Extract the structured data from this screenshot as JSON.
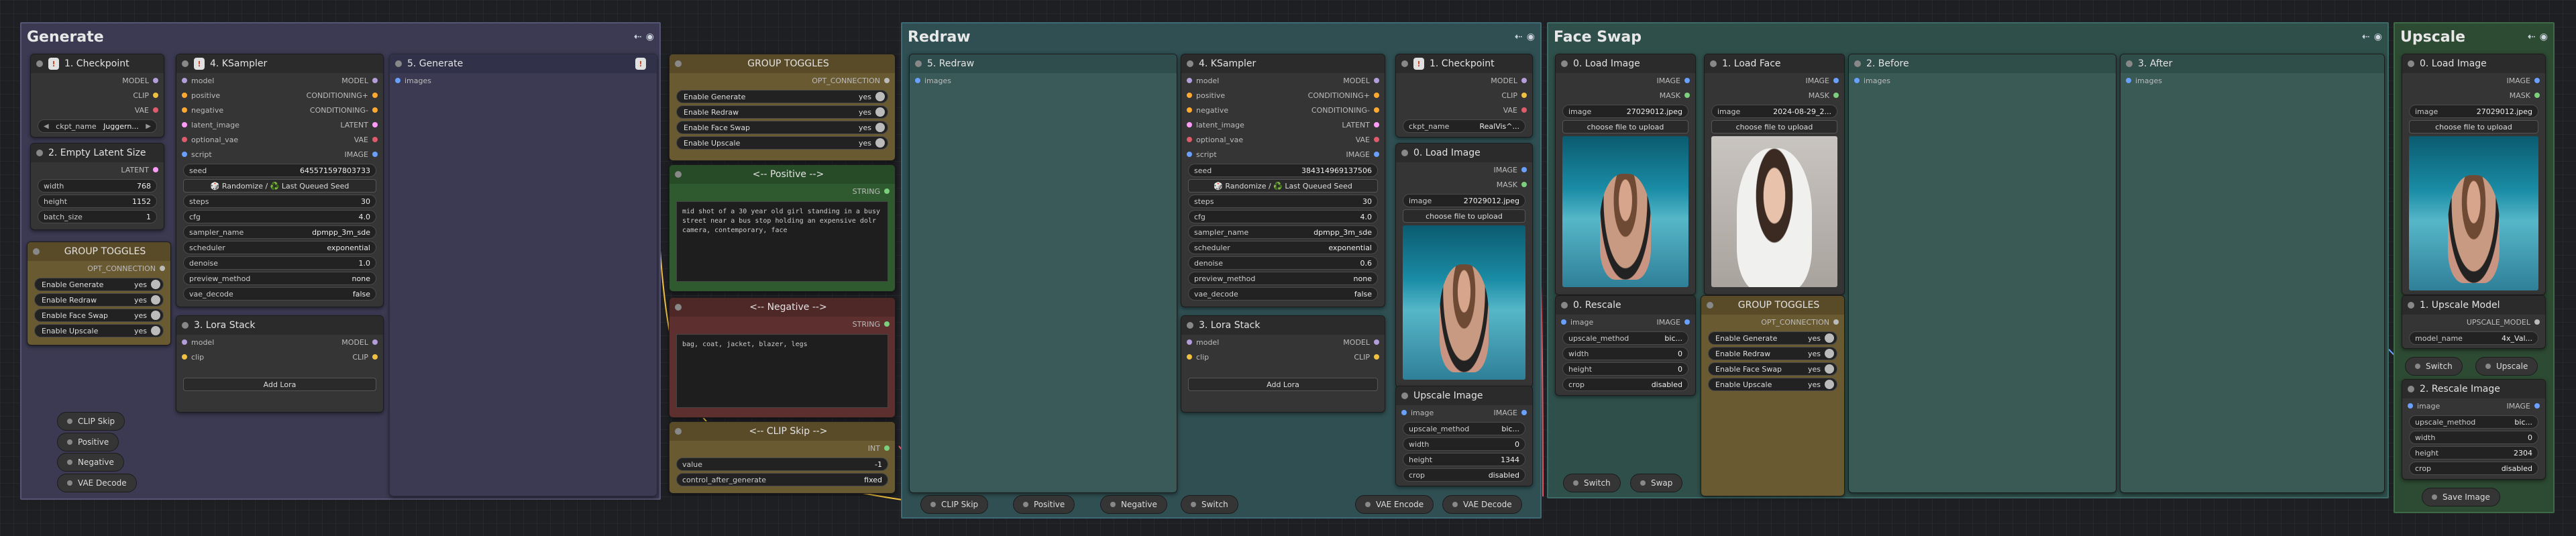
{
  "groups": {
    "generate": "Generate",
    "redraw": "Redraw",
    "faceswap": "Face Swap",
    "upscale": "Upscale"
  },
  "colors": {
    "generate": "#3b3a52",
    "redraw": "#2f4f53",
    "faceswap": "#2f4f4b",
    "upscale": "#2d4a33",
    "toggles": "#6a5a32",
    "positive": "#2f5a2f",
    "negative": "#5e2f2f",
    "clip_skip": "#6a5a32",
    "wire_red": "#e05c6c",
    "wire_yellow": "#f0c040",
    "wire_blue": "#6aa0ff"
  },
  "icons": {
    "pin": "pin-icon",
    "eye": "eye-icon"
  },
  "gen": {
    "checkpoint": {
      "title": "1. Checkpoint",
      "outputs": [
        "MODEL",
        "CLIP",
        "VAE"
      ],
      "widget_label": "ckpt_name",
      "widget_value": "Juggern..."
    },
    "latent": {
      "title": "2. Empty Latent Size",
      "output": "LATENT",
      "width_label": "width",
      "width": "768",
      "height_label": "height",
      "height": "1152",
      "batch_label": "batch_size",
      "batch": "1"
    },
    "toggles": {
      "title": "GROUP TOGGLES",
      "output": "OPT_CONNECTION",
      "items": [
        {
          "label": "Enable Generate",
          "value": "yes"
        },
        {
          "label": "Enable Redraw",
          "value": "yes"
        },
        {
          "label": "Enable Face Swap",
          "value": "yes"
        },
        {
          "label": "Enable Upscale",
          "value": "yes"
        }
      ]
    },
    "ksampler": {
      "title": "4. KSampler",
      "inputs": [
        "model",
        "positive",
        "negative",
        "latent_image",
        "optional_vae",
        "script"
      ],
      "outputs": [
        "MODEL",
        "CONDITIONING+",
        "CONDITIONING-",
        "LATENT",
        "VAE",
        "IMAGE"
      ],
      "seed_label": "seed",
      "seed": "645571597803733",
      "randomize": "🎲 Randomize / ♻️ Last Queued Seed",
      "steps_label": "steps",
      "steps": "30",
      "cfg_label": "cfg",
      "cfg": "4.0",
      "sampler_label": "sampler_name",
      "sampler": "dpmpp_3m_sde",
      "scheduler_label": "scheduler",
      "scheduler": "exponential",
      "denoise_label": "denoise",
      "denoise": "1.0",
      "preview_label": "preview_method",
      "preview": "none",
      "vae_decode_label": "vae_decode",
      "vae_decode": "false"
    },
    "lora": {
      "title": "3. Lora Stack",
      "inputs": [
        "model",
        "clip"
      ],
      "outputs": [
        "MODEL",
        "CLIP"
      ],
      "add": "Add Lora"
    },
    "save": {
      "title": "5. Generate",
      "input": "images"
    },
    "pills": [
      "CLIP Skip",
      "Positive",
      "Negative",
      "VAE Decode"
    ]
  },
  "mid": {
    "toggles": {
      "title": "GROUP TOGGLES",
      "output": "OPT_CONNECTION",
      "items": [
        {
          "label": "Enable Generate",
          "value": "yes"
        },
        {
          "label": "Enable Redraw",
          "value": "yes"
        },
        {
          "label": "Enable Face Swap",
          "value": "yes"
        },
        {
          "label": "Enable Upscale",
          "value": "yes"
        }
      ]
    },
    "positive": {
      "title": "<-- Positive -->",
      "output": "STRING",
      "text": "mid shot of a 30 year old girl standing in a busy street near a bus stop holding an expensive dolr camera, contemporary, face"
    },
    "negative": {
      "title": "<-- Negative -->",
      "output": "STRING",
      "text": "bag, coat, jacket, blazer, legs"
    },
    "clipskip": {
      "title": "<-- CLIP Skip -->",
      "output": "INT",
      "value_label": "value",
      "value": "-1",
      "control_label": "control_after_generate",
      "control": "fixed"
    }
  },
  "redraw": {
    "save": {
      "title": "5. Redraw",
      "input": "images"
    },
    "ksampler": {
      "title": "4. KSampler",
      "inputs": [
        "model",
        "positive",
        "negative",
        "latent_image",
        "optional_vae",
        "script"
      ],
      "outputs": [
        "MODEL",
        "CONDITIONING+",
        "CONDITIONING-",
        "LATENT",
        "VAE",
        "IMAGE"
      ],
      "seed_label": "seed",
      "seed": "384314969137506",
      "randomize": "🎲 Randomize / ♻️ Last Queued Seed",
      "steps_label": "steps",
      "steps": "30",
      "cfg_label": "cfg",
      "cfg": "4.0",
      "sampler_label": "sampler_name",
      "sampler": "dpmpp_3m_sde",
      "scheduler_label": "scheduler",
      "scheduler": "exponential",
      "denoise_label": "denoise",
      "denoise": "0.6",
      "preview_label": "preview_method",
      "preview": "none",
      "vae_decode_label": "vae_decode",
      "vae_decode": "false"
    },
    "lora": {
      "title": "3. Lora Stack",
      "inputs": [
        "model",
        "clip"
      ],
      "outputs": [
        "MODEL",
        "CLIP"
      ],
      "add": "Add Lora"
    },
    "checkpoint": {
      "title": "1. Checkpoint",
      "outputs": [
        "MODEL",
        "CLIP",
        "VAE"
      ],
      "widget_label": "ckpt_name",
      "widget_value": "RealVis^..."
    },
    "load": {
      "title": "0. Load Image",
      "outputs": [
        "IMAGE",
        "MASK"
      ],
      "image_label": "image",
      "image": "27029012.jpeg",
      "upload": "choose file to upload"
    },
    "upscale": {
      "title": "Upscale Image",
      "input": "image",
      "output": "IMAGE",
      "method_label": "upscale_method",
      "method": "bic...",
      "width_label": "width",
      "width": "0",
      "height_label": "height",
      "height": "1344",
      "crop_label": "crop",
      "crop": "disabled"
    },
    "pills": [
      "CLIP Skip",
      "Positive",
      "Negative",
      "Switch",
      "VAE Encode",
      "VAE Decode"
    ]
  },
  "face": {
    "load_image": {
      "title": "0. Load Image",
      "outputs": [
        "IMAGE",
        "MASK"
      ],
      "image_label": "image",
      "image": "27029012.jpeg",
      "upload": "choose file to upload"
    },
    "load_face": {
      "title": "1. Load Face",
      "outputs": [
        "IMAGE",
        "MASK"
      ],
      "image_label": "image",
      "image": "2024-08-29_2...",
      "upload": "choose file to upload"
    },
    "before": {
      "title": "2. Before",
      "input": "images"
    },
    "after": {
      "title": "3. After",
      "input": "images"
    },
    "rescale": {
      "title": "0. Rescale",
      "input": "image",
      "output": "IMAGE",
      "method_label": "upscale_method",
      "method": "bic...",
      "width_label": "width",
      "width": "0",
      "height_label": "height",
      "height": "0",
      "crop_label": "crop",
      "crop": "disabled"
    },
    "toggles": {
      "title": "GROUP TOGGLES",
      "output": "OPT_CONNECTION",
      "items": [
        {
          "label": "Enable Generate",
          "value": "yes"
        },
        {
          "label": "Enable Redraw",
          "value": "yes"
        },
        {
          "label": "Enable Face Swap",
          "value": "yes"
        },
        {
          "label": "Enable Upscale",
          "value": "yes"
        }
      ]
    },
    "pills": [
      "Switch",
      "Swap"
    ]
  },
  "up": {
    "load": {
      "title": "0. Load Image",
      "outputs": [
        "IMAGE",
        "MASK"
      ],
      "image_label": "image",
      "image": "27029012.jpeg",
      "upload": "choose file to upload"
    },
    "model": {
      "title": "1. Upscale Model",
      "output": "UPSCALE_MODEL",
      "model_label": "model_name",
      "model": "4x_Val..."
    },
    "switch": "Switch",
    "upscale_pill": "Upscale",
    "rescale": {
      "title": "2. Rescale Image",
      "input": "image",
      "output": "IMAGE",
      "method_label": "upscale_method",
      "method": "bic...",
      "width_label": "width",
      "width": "0",
      "height_label": "height",
      "height": "2304",
      "crop_label": "crop",
      "crop": "disabled"
    },
    "save": "Save Image"
  }
}
